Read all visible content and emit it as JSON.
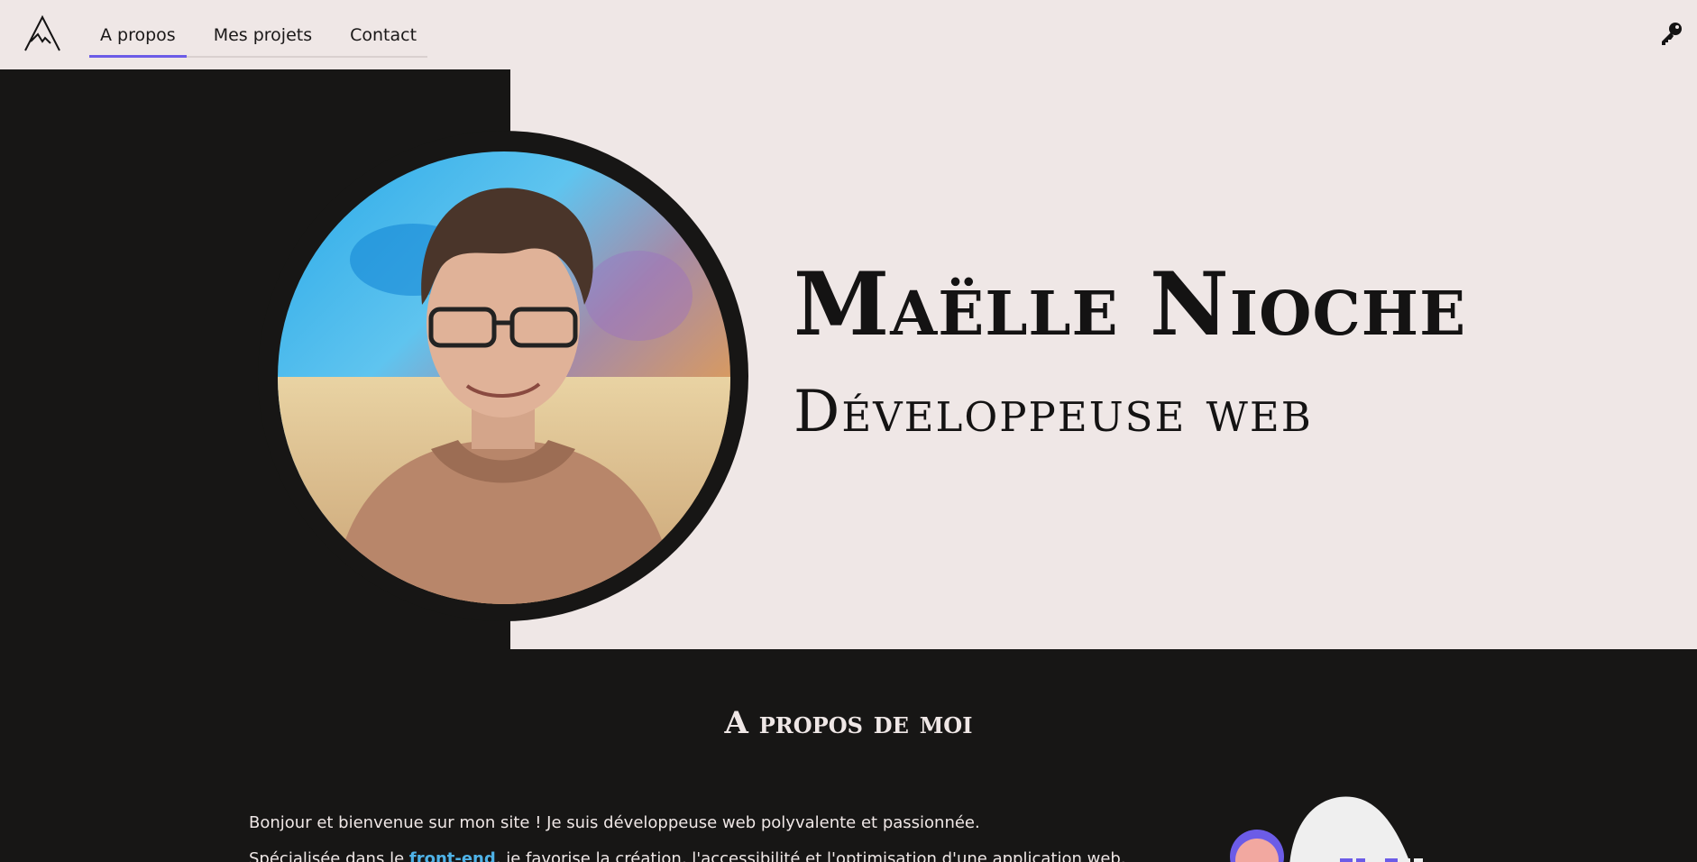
{
  "nav": {
    "items": [
      {
        "label": "A propos",
        "active": true
      },
      {
        "label": "Mes projets",
        "active": false
      },
      {
        "label": "Contact",
        "active": false
      }
    ],
    "active_color": "#6c5ce7"
  },
  "hero": {
    "name": "Maëlle Nioche",
    "role": "Développeuse web"
  },
  "about": {
    "title": "A propos de moi",
    "intro": "Bonjour et bienvenue sur mon site ! Je suis développeuse web polyvalente et passionnée.",
    "p2_before": "Spécialisée dans le ",
    "p2_link": "front-end",
    "p2_after": ", je favorise la création, l'accessibilité et l'optimisation d'une application web."
  },
  "icons": {
    "logo": "mountain-logo-icon",
    "key": "key-icon"
  },
  "colors": {
    "dark": "#171615",
    "light": "#efe7e6",
    "accent": "#6c5ce7",
    "link": "#4fb3e8"
  }
}
